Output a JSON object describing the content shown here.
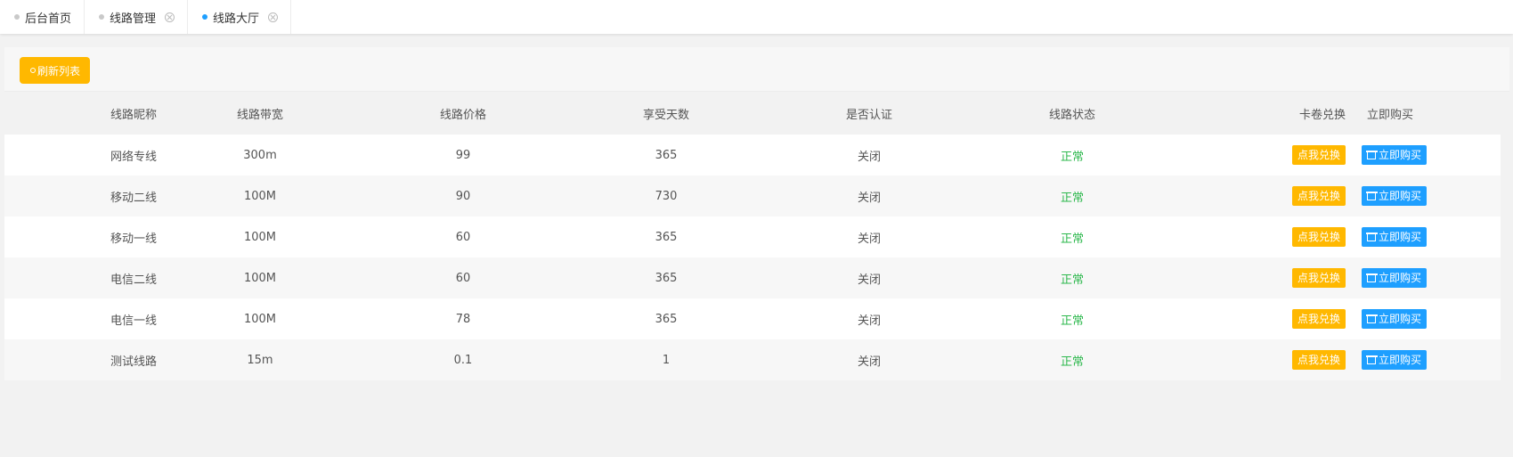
{
  "tabs": [
    {
      "label": "后台首页",
      "closable": false,
      "active": false
    },
    {
      "label": "线路管理",
      "closable": true,
      "active": false
    },
    {
      "label": "线路大厅",
      "closable": true,
      "active": true
    }
  ],
  "toolbar": {
    "refresh_label": "刷新列表"
  },
  "table": {
    "headers": [
      "线路昵称",
      "线路带宽",
      "线路价格",
      "享受天数",
      "是否认证",
      "线路状态",
      "卡卷兑换",
      "立即购买"
    ],
    "rows": [
      {
        "name": "网络专线",
        "bandwidth": "300m",
        "price": "99",
        "days": "365",
        "verified": "关闭",
        "status": "正常",
        "exchange": "点我兑换",
        "buy": "立即购买"
      },
      {
        "name": "移动二线",
        "bandwidth": "100M",
        "price": "90",
        "days": "730",
        "verified": "关闭",
        "status": "正常",
        "exchange": "点我兑换",
        "buy": "立即购买"
      },
      {
        "name": "移动一线",
        "bandwidth": "100M",
        "price": "60",
        "days": "365",
        "verified": "关闭",
        "status": "正常",
        "exchange": "点我兑换",
        "buy": "立即购买"
      },
      {
        "name": "电信二线",
        "bandwidth": "100M",
        "price": "60",
        "days": "365",
        "verified": "关闭",
        "status": "正常",
        "exchange": "点我兑换",
        "buy": "立即购买"
      },
      {
        "name": "电信一线",
        "bandwidth": "100M",
        "price": "78",
        "days": "365",
        "verified": "关闭",
        "status": "正常",
        "exchange": "点我兑换",
        "buy": "立即购买"
      },
      {
        "name": "测试线路",
        "bandwidth": "15m",
        "price": "0.1",
        "days": "1",
        "verified": "关闭",
        "status": "正常",
        "exchange": "点我兑换",
        "buy": "立即购买"
      }
    ]
  },
  "colors": {
    "accent_yellow": "#ffb800",
    "accent_blue": "#1e9fff",
    "status_green": "#2db84d"
  }
}
